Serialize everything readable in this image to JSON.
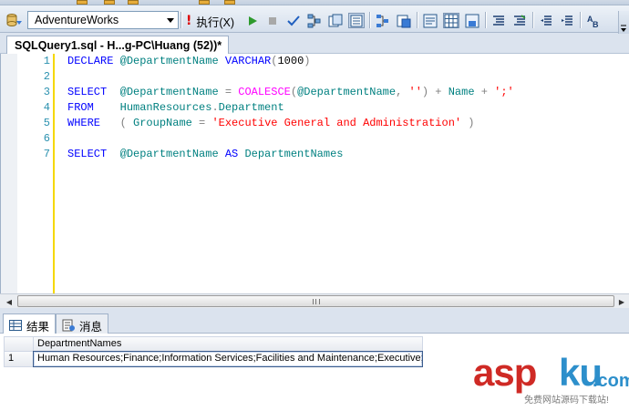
{
  "toolbar": {
    "database": "AdventureWorks",
    "execute_label": "执行(X)"
  },
  "document_tab": {
    "title": "SQLQuery1.sql - H...g-PC\\Huang (52))*"
  },
  "editor": {
    "line_numbers": [
      "1",
      "2",
      "3",
      "4",
      "5",
      "6",
      "7"
    ],
    "lines": [
      [
        {
          "t": "DECLARE",
          "c": "kw"
        },
        {
          "t": " @DepartmentName ",
          "c": "var"
        },
        {
          "t": "VARCHAR",
          "c": "kw"
        },
        {
          "t": "(",
          "c": "op"
        },
        {
          "t": "1000",
          "c": ""
        },
        {
          "t": ")",
          "c": "op"
        }
      ],
      [],
      [
        {
          "t": "SELECT",
          "c": "kw"
        },
        {
          "t": "  @DepartmentName ",
          "c": "var"
        },
        {
          "t": "=",
          "c": "op"
        },
        {
          "t": " ",
          "c": ""
        },
        {
          "t": "COALESCE",
          "c": "fn"
        },
        {
          "t": "(",
          "c": "op"
        },
        {
          "t": "@DepartmentName",
          "c": "var"
        },
        {
          "t": ", ",
          "c": "op"
        },
        {
          "t": "''",
          "c": "str"
        },
        {
          "t": ") + ",
          "c": "op"
        },
        {
          "t": "Name",
          "c": "id"
        },
        {
          "t": " + ",
          "c": "op"
        },
        {
          "t": "';'",
          "c": "str"
        }
      ],
      [
        {
          "t": "FROM",
          "c": "kw"
        },
        {
          "t": "    HumanResources",
          "c": "id"
        },
        {
          "t": ".",
          "c": "op"
        },
        {
          "t": "Department",
          "c": "id"
        }
      ],
      [
        {
          "t": "WHERE",
          "c": "kw"
        },
        {
          "t": "   ( ",
          "c": "op"
        },
        {
          "t": "GroupName",
          "c": "id"
        },
        {
          "t": " = ",
          "c": "op"
        },
        {
          "t": "'Executive General and Administration'",
          "c": "str"
        },
        {
          "t": " )",
          "c": "op"
        }
      ],
      [],
      [
        {
          "t": "SELECT",
          "c": "kw"
        },
        {
          "t": "  @DepartmentName ",
          "c": "var"
        },
        {
          "t": "AS",
          "c": "kw"
        },
        {
          "t": " DepartmentNames",
          "c": "id"
        }
      ]
    ]
  },
  "results": {
    "tabs": [
      {
        "label": "结果"
      },
      {
        "label": "消息"
      }
    ],
    "grid": {
      "columns": [
        "DepartmentNames"
      ],
      "rows": [
        {
          "num": "1",
          "cells": [
            "Human Resources;Finance;Information Services;Facilities and Maintenance;Executive;"
          ]
        }
      ]
    }
  },
  "watermark": {
    "asp": "asp",
    "ku": "ku",
    "tld": ".com",
    "sub": "免费网站源码下载站!"
  }
}
